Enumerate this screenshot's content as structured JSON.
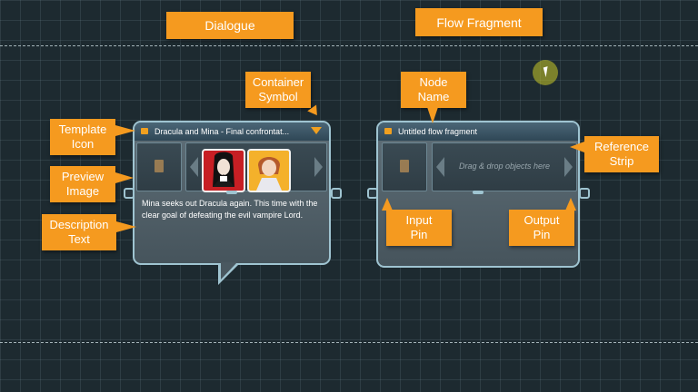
{
  "section_labels": {
    "dialogue": "Dialogue",
    "flow_fragment": "Flow Fragment"
  },
  "callouts": {
    "container_symbol": "Container\nSymbol",
    "template_icon": "Template\nIcon",
    "preview_image": "Preview\nImage",
    "description_text": "Description\nText",
    "node_name": "Node\nName",
    "reference_strip": "Reference\nStrip",
    "input_pin": "Input\nPin",
    "output_pin": "Output\nPin"
  },
  "dialogue_node": {
    "title": "Dracula and Mina - Final confrontat...",
    "description": "Mina seeks out Dracula again. This time with the clear goal of defeating the evil vampire Lord."
  },
  "flow_node": {
    "title": "Untitled flow fragment",
    "drop_placeholder": "Drag & drop objects here"
  },
  "colors": {
    "callout": "#f59a1f",
    "node_border": "#9fc4d1",
    "accent_header_icon": "#f0a020"
  }
}
